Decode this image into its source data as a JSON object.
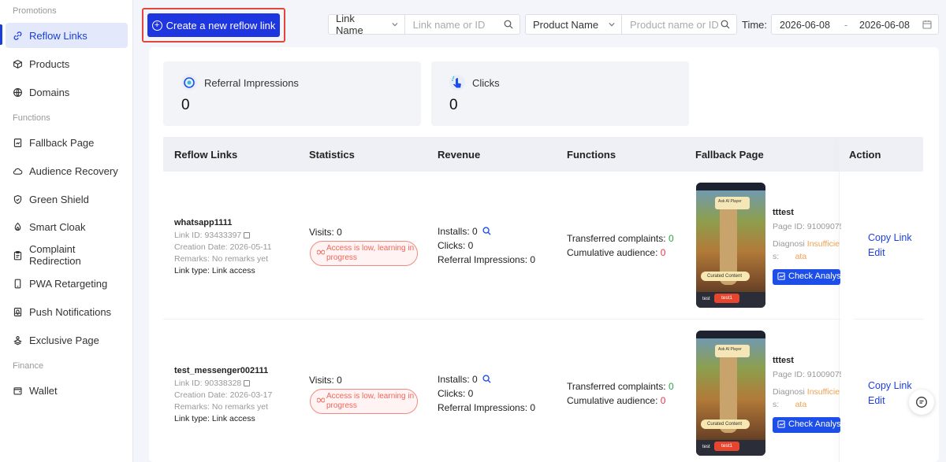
{
  "sidebar": {
    "sections": {
      "promotions": "Promotions",
      "functions": "Functions",
      "finance": "Finance"
    },
    "items": [
      {
        "label": "Reflow Links",
        "icon": "link-icon"
      },
      {
        "label": "Products",
        "icon": "box-icon"
      },
      {
        "label": "Domains",
        "icon": "globe-icon"
      },
      {
        "label": "Fallback Page",
        "icon": "document-icon"
      },
      {
        "label": "Audience Recovery",
        "icon": "cloud-icon"
      },
      {
        "label": "Green Shield",
        "icon": "shield-icon"
      },
      {
        "label": "Smart Cloak",
        "icon": "flame-icon"
      },
      {
        "label": "Complaint Redirection",
        "icon": "clipboard-icon"
      },
      {
        "label": "PWA Retargeting",
        "icon": "phone-icon"
      },
      {
        "label": "Push Notifications",
        "icon": "bell-icon"
      },
      {
        "label": "Exclusive Page",
        "icon": "stack-icon"
      },
      {
        "label": "Wallet",
        "icon": "wallet-icon"
      }
    ]
  },
  "toolbar": {
    "create_label": "Create a new reflow link",
    "link_filter": {
      "selected": "Link Name",
      "placeholder": "Link name or ID"
    },
    "product_filter": {
      "selected": "Product Name",
      "placeholder": "Product name or ID"
    },
    "time_label": "Time:",
    "date_start": "2026-06-08",
    "date_sep": "-",
    "date_end": "2026-06-08"
  },
  "stats": {
    "impressions": {
      "label": "Referral Impressions",
      "value": "0"
    },
    "clicks": {
      "label": "Clicks",
      "value": "0"
    }
  },
  "table": {
    "headers": [
      "Reflow Links",
      "Statistics",
      "Revenue",
      "Functions",
      "Fallback Page",
      "Action"
    ],
    "rows": [
      {
        "name": "whatsapp1111",
        "link_id_label": "Link ID:",
        "link_id": "93433397",
        "creation_label": "Creation Date:",
        "creation": "2026-05-11",
        "remarks_label": "Remarks:",
        "remarks": "No remarks yet",
        "type_label": "Link type:",
        "type": "Link access",
        "visits": "Visits:  0",
        "warning": "Access is low, learning in progress",
        "installs_label": "Installs:  0",
        "clicks": "Clicks:  0",
        "ref_impr": "Referral Impressions:  0",
        "complaints_label": "Transferred complaints:",
        "complaints": "0",
        "audience_label": "Cumulative audience:",
        "audience": "0",
        "fb_title": "tttest",
        "fb_page_id_label": "Page ID:",
        "fb_page_id": "91009075",
        "fb_diag_label_1": "Diagnosi",
        "fb_diag_label_2": "s:",
        "fb_diag_val_1": "Insufficie",
        "fb_diag_val_2": "ata",
        "check_label": "Check Analysis",
        "phone_pill": "Ask AI Player",
        "phone_curated": "Curated Content",
        "phone_tlabel": "test",
        "phone_tbtn": "test1",
        "copy_label": "Copy Link",
        "edit_label": "Edit"
      },
      {
        "name": "test_messenger002111",
        "link_id_label": "Link ID:",
        "link_id": "90338328",
        "creation_label": "Creation Date:",
        "creation": "2026-03-17",
        "remarks_label": "Remarks:",
        "remarks": "No remarks yet",
        "type_label": "Link type:",
        "type": "Link access",
        "visits": "Visits:  0",
        "warning": "Access is low, learning in progress",
        "installs_label": "Installs:  0",
        "clicks": "Clicks:  0",
        "ref_impr": "Referral Impressions:  0",
        "complaints_label": "Transferred complaints:",
        "complaints": "0",
        "audience_label": "Cumulative audience:",
        "audience": "0",
        "fb_title": "tttest",
        "fb_page_id_label": "Page ID:",
        "fb_page_id": "91009075",
        "fb_diag_label_1": "Diagnosi",
        "fb_diag_label_2": "s:",
        "fb_diag_val_1": "Insufficie",
        "fb_diag_val_2": "ata",
        "check_label": "Check Analysis",
        "phone_pill": "Ask AI Player",
        "phone_curated": "Curated Content",
        "phone_tlabel": "test",
        "phone_tbtn": "test1",
        "copy_label": "Copy Link",
        "edit_label": "Edit"
      }
    ]
  },
  "colors": {
    "accent": "#1d36e0",
    "active_bg": "#e3e9fb",
    "warning": "#f0655a",
    "success": "#27a84a",
    "danger": "#e5344b"
  }
}
